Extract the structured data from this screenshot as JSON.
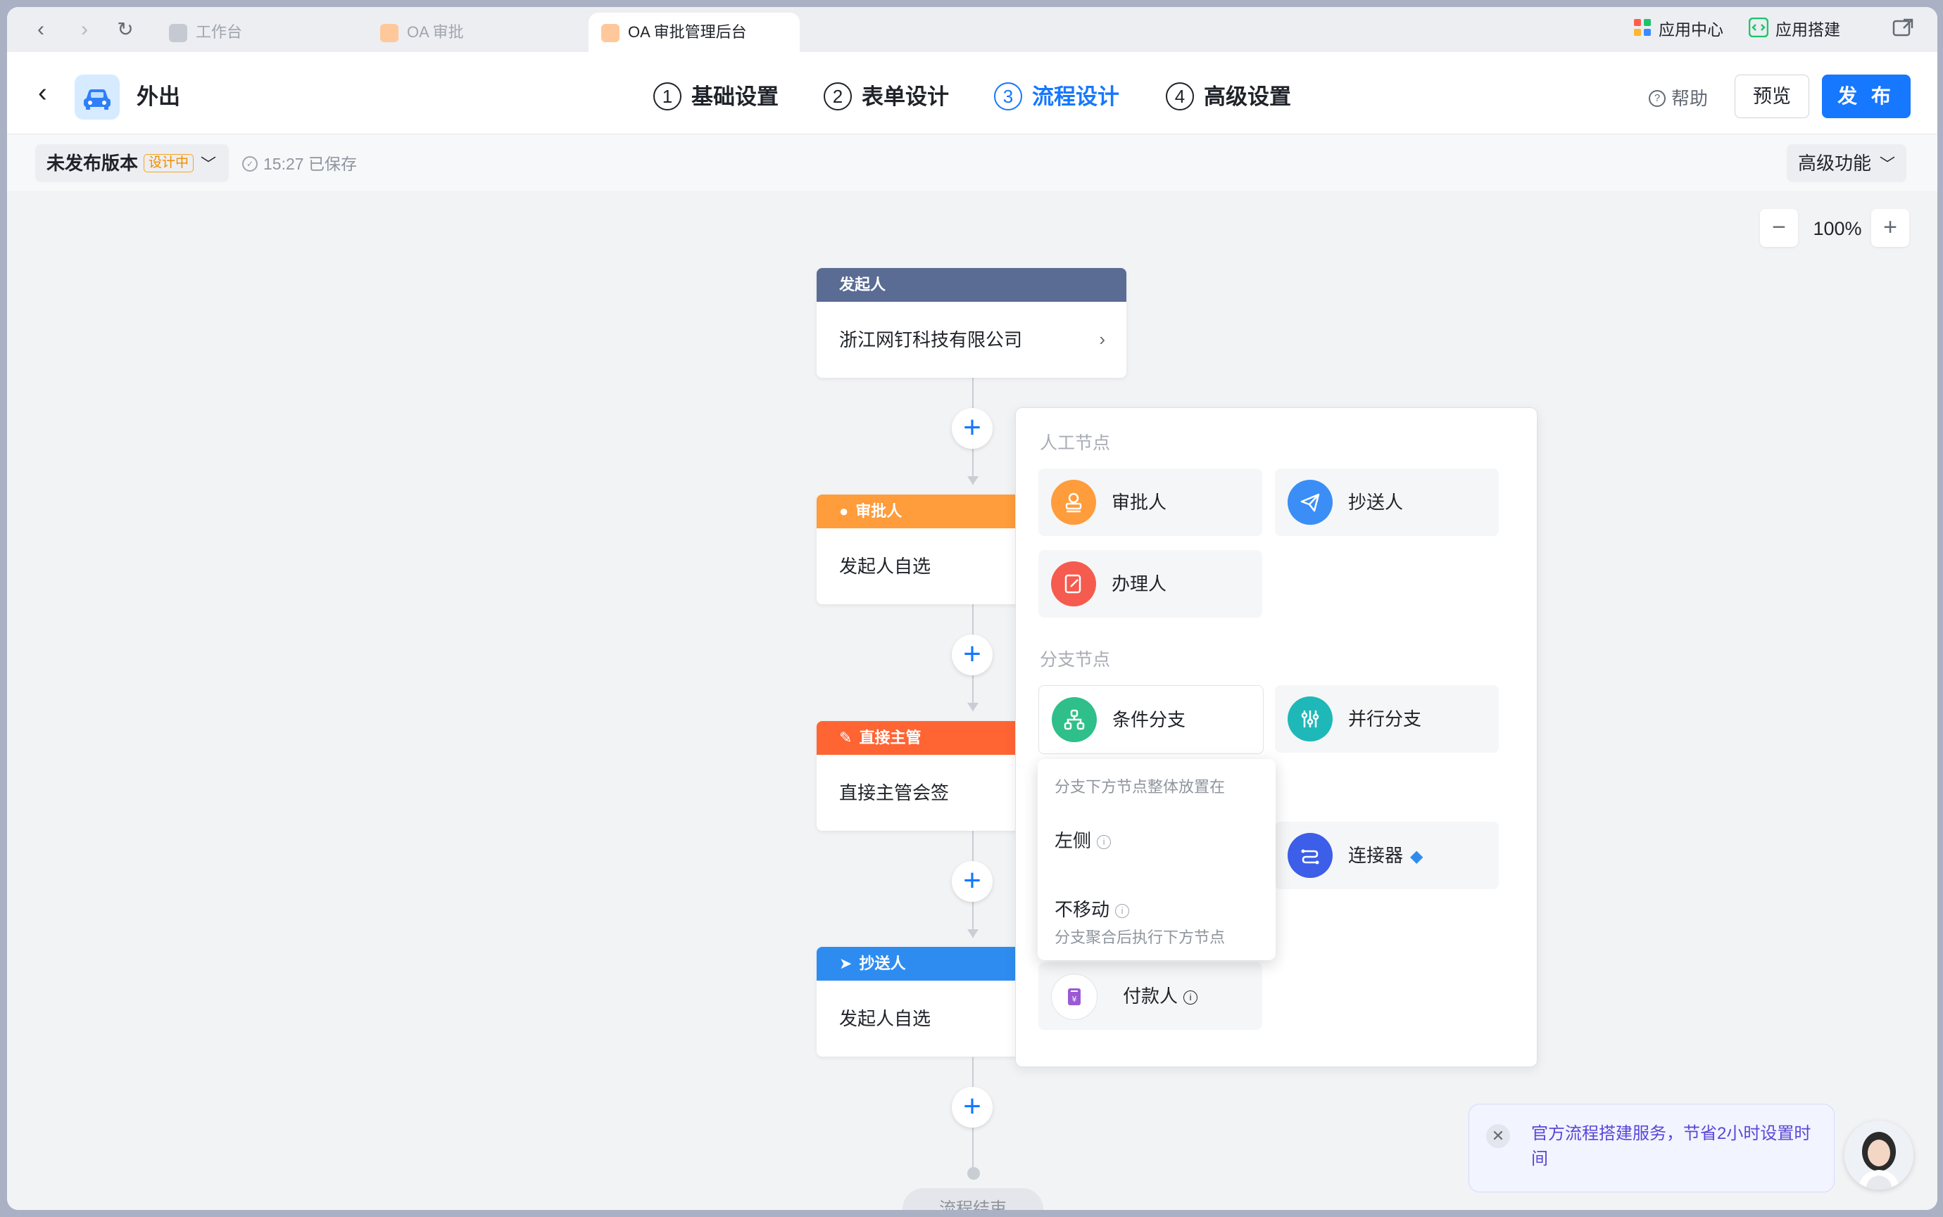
{
  "tabs": [
    {
      "label": "工作台",
      "active": false
    },
    {
      "label": "OA 审批",
      "active": false
    },
    {
      "label": "OA 审批管理后台",
      "active": true
    }
  ],
  "top_links": {
    "app_center": "应用中心",
    "app_build": "应用搭建"
  },
  "header": {
    "app_name": "外出",
    "steps": [
      {
        "num": "1",
        "label": "基础设置"
      },
      {
        "num": "2",
        "label": "表单设计"
      },
      {
        "num": "3",
        "label": "流程设计"
      },
      {
        "num": "4",
        "label": "高级设置"
      }
    ],
    "active_step": 3,
    "help": "帮助",
    "preview": "预览",
    "publish": "发 布"
  },
  "toolbar": {
    "version": "未发布版本",
    "badge": "设计中",
    "saved": "15:27 已保存",
    "advanced": "高级功能"
  },
  "zoom": {
    "value": "100%",
    "minus": "−",
    "plus": "+"
  },
  "flow": {
    "nodes": [
      {
        "title": "发起人",
        "body": "浙江网钉科技有限公司",
        "color": "#5a6b94"
      },
      {
        "title": "审批人",
        "body": "发起人自选",
        "color": "#ff9c3b"
      },
      {
        "title": "直接主管",
        "body": "直接主管会签",
        "color": "#ff6433"
      },
      {
        "title": "抄送人",
        "body": "发起人自选",
        "color": "#2e8cf0"
      }
    ],
    "end": "流程结束"
  },
  "panel": {
    "section_manual": "人工节点",
    "section_branch": "分支节点",
    "items": {
      "approver": "审批人",
      "cc": "抄送人",
      "handler": "办理人",
      "condition": "条件分支",
      "parallel": "并行分支",
      "connector": "连接器",
      "payer": "付款人"
    }
  },
  "dropdown": {
    "title": "分支下方节点整体放置在",
    "opt_left": "左侧",
    "opt_nomove": "不移动",
    "opt_nomove_desc": "分支聚合后执行下方节点"
  },
  "promo": {
    "text": "官方流程搭建服务，节省2小时设置时间"
  },
  "colors": {
    "primary": "#1677ff",
    "approver": "#ff9c3b",
    "supervisor": "#ff6433",
    "cc": "#2e8cf0",
    "initiator": "#5a6b94"
  }
}
